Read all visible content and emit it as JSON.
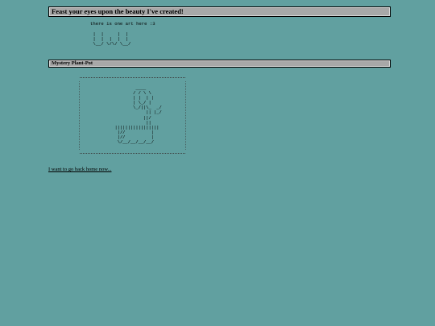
{
  "header": {
    "title": "Feast your eyes upon the beauty I've created!"
  },
  "intro": {
    "caption": "there is one art here :3",
    "art": " |  |     |  |\n |  |  |  |  |\n \\__/ \\/\\/ \\__/"
  },
  "section": {
    "title": "Mystery Plant-Pot",
    "art": "          ____\n         / / \\ \\\n         | |  | |\n         | \\_/ |\n         \\_/||\\_  _/\n              || |_/\n             ||/\n              ||\n  |||||||||||||||||\n   |//          |\n   |//          |\n   \\/__/__/__/__/"
  },
  "footer": {
    "link_label": "I want to go back home now..."
  }
}
